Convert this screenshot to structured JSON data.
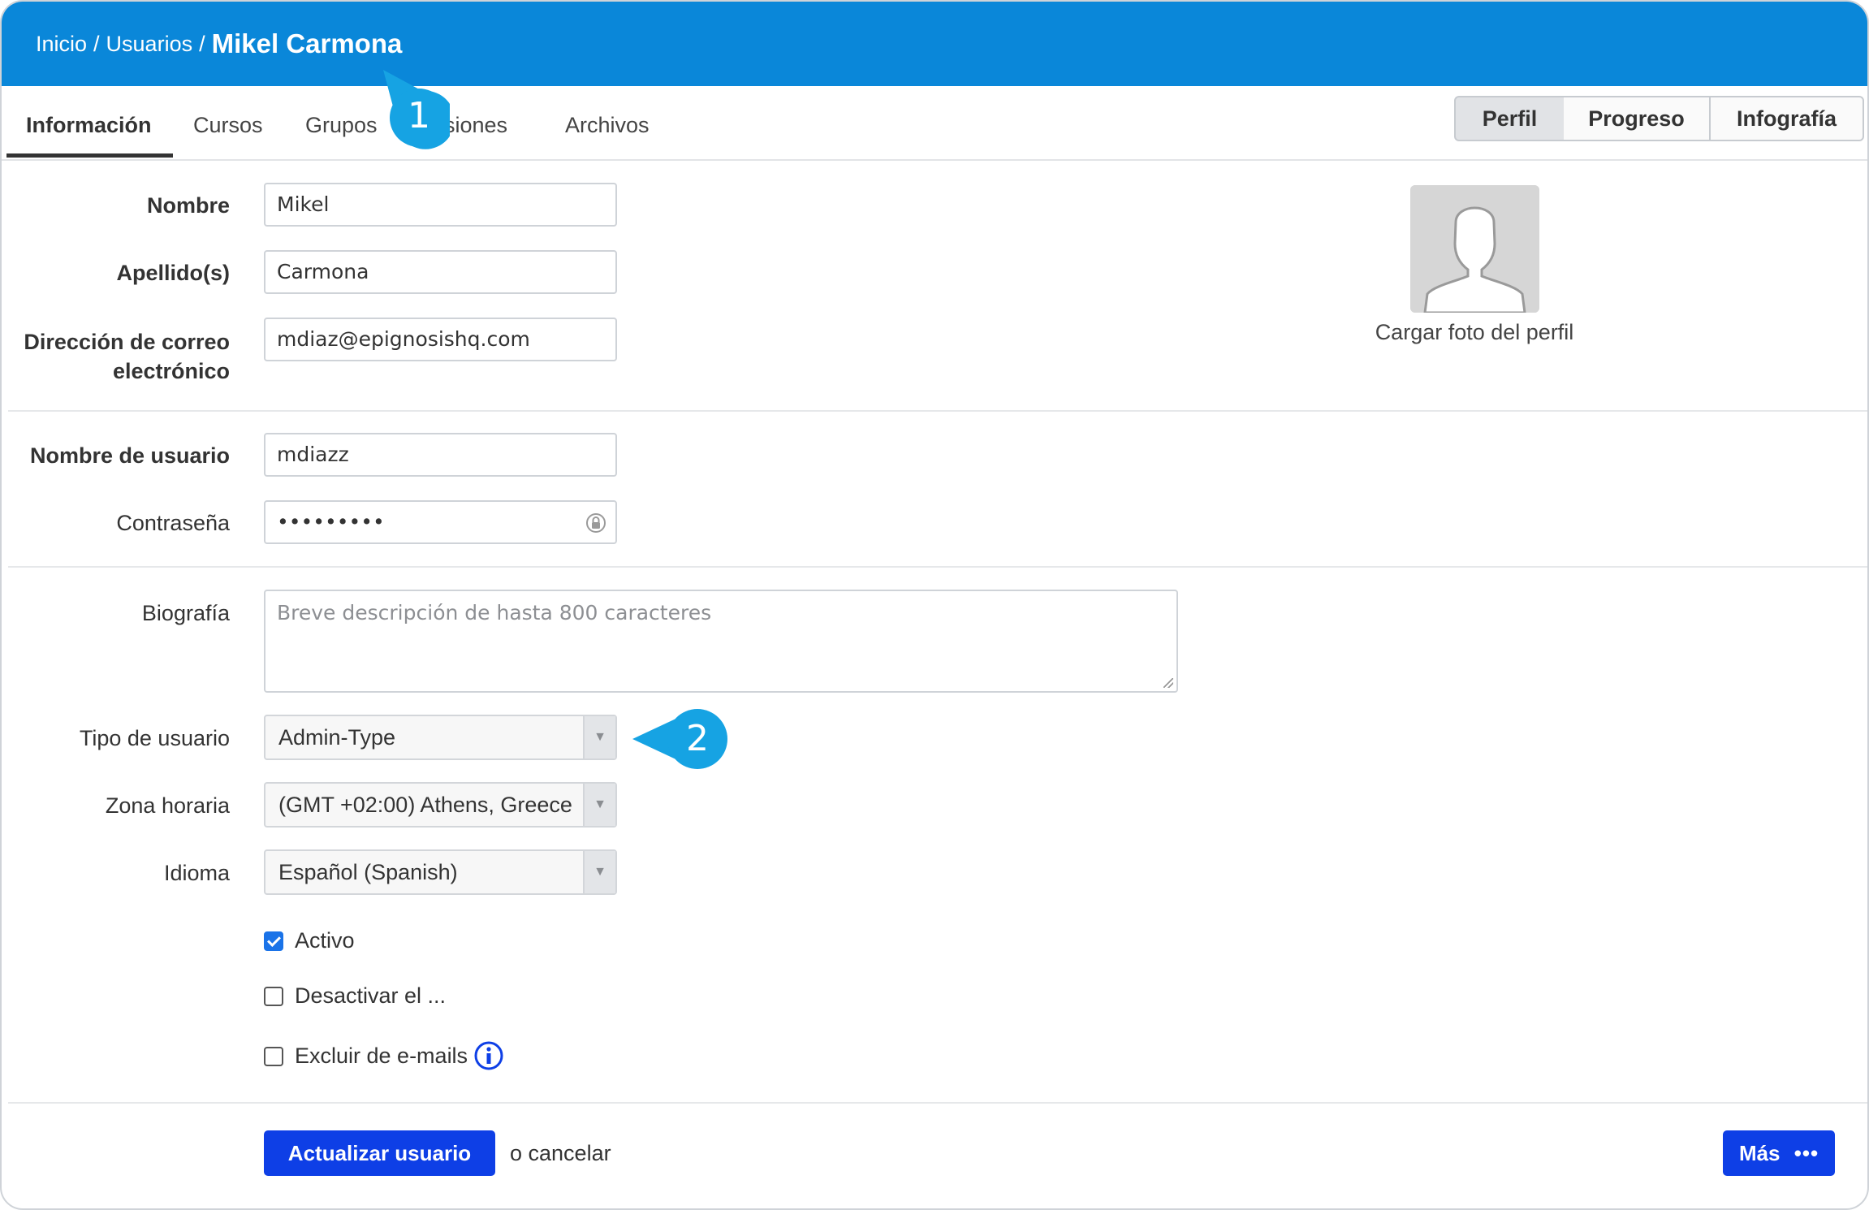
{
  "breadcrumb": {
    "home": "Inicio",
    "users": "Usuarios",
    "current": "Mikel Carmona"
  },
  "tabs": [
    {
      "label": "Información",
      "active": true
    },
    {
      "label": "Cursos"
    },
    {
      "label": "Grupos"
    },
    {
      "label": "Divisiones"
    },
    {
      "label": "Archivos"
    }
  ],
  "view_switch": {
    "profile": "Perfil",
    "progress": "Progreso",
    "infographic": "Infografía"
  },
  "form": {
    "first_name_label": "Nombre",
    "first_name_value": "Mikel",
    "last_name_label": "Apellido(s)",
    "last_name_value": "Carmona",
    "email_label_line1": "Dirección de correo",
    "email_label_line2": "electrónico",
    "email_value": "mdiaz@epignosishq.com",
    "username_label": "Nombre de usuario",
    "username_value": "mdiazz",
    "password_label": "Contraseña",
    "password_value": "•••••••••",
    "bio_label": "Biografía",
    "bio_placeholder": "Breve descripción de hasta 800 caracteres",
    "user_type_label": "Tipo de usuario",
    "user_type_value": "Admin-Type",
    "timezone_label": "Zona horaria",
    "timezone_value": "(GMT +02:00) Athens, Greece",
    "language_label": "Idioma",
    "language_value": "Español (Spanish)",
    "active_label": "Activo",
    "active_checked": true,
    "deactivate_label": "Desactivar el ...",
    "exclude_emails_label": "Excluir de e-mails"
  },
  "avatar": {
    "upload_label": "Cargar foto del perfil"
  },
  "actions": {
    "update_label": "Actualizar usuario",
    "cancel_label": "o cancelar",
    "more_label": "Más"
  },
  "callouts": {
    "first": "1",
    "second": "2"
  },
  "colors": {
    "header": "#0a87d9",
    "primary_button": "#0e3fe6",
    "callout": "#16a3e3"
  }
}
